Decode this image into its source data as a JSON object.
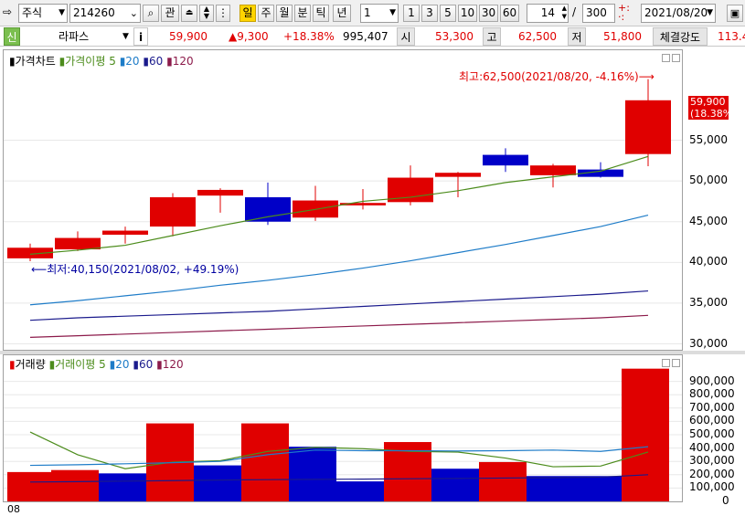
{
  "toolbar": {
    "market_type": "주식",
    "code": "214260",
    "btn_watch": "관",
    "period_active": "일",
    "periods": [
      "주",
      "월",
      "분",
      "틱",
      "년"
    ],
    "interval_value": "1",
    "minute_buttons": [
      "1",
      "3",
      "5",
      "10",
      "30",
      "60"
    ],
    "view_count": "14",
    "separator": "/",
    "total_count": "300",
    "date_value": "2021/08/20"
  },
  "infobar": {
    "badge": "신",
    "stock_name": "라파스",
    "info_button": "i",
    "price": "59,900",
    "change": "▲9,300",
    "change_pct": "+18.38%",
    "volume": "995,407",
    "open_label": "시",
    "open_value": "53,300",
    "high_label": "고",
    "high_value": "62,500",
    "low_label": "저",
    "low_value": "51,800",
    "strength_label": "체결강도",
    "strength_value": "113.4"
  },
  "price_panel": {
    "legend": {
      "title": "가격차트",
      "ma_title": "가격이평",
      "ma_periods": [
        "5",
        "20",
        "60",
        "120"
      ]
    },
    "high_annotation": "최고:62,500(2021/08/20, -4.16%)⟶",
    "low_annotation": "⟵최저:40,150(2021/08/02, +49.19%)",
    "current_tag_price": "59,900",
    "current_tag_pct": "(18.38%)"
  },
  "volume_panel": {
    "legend": {
      "title": "거래량",
      "ma_title": "거래이평",
      "ma_periods": [
        "5",
        "20",
        "60",
        "120"
      ]
    }
  },
  "bottom_label": "08",
  "colors": {
    "up": "#e00000",
    "down": "#0000c8",
    "ma5": "#4c8c1c",
    "ma20": "#1e7cc8",
    "ma60": "#1a1a8c",
    "ma120": "#8c1a4a",
    "grid": "#e8e8e8"
  },
  "chart_data": [
    {
      "type": "candlestick",
      "title": "가격차트",
      "y_ticks": [
        "30,000",
        "35,000",
        "40,000",
        "45,000",
        "50,000",
        "55,000"
      ],
      "ylim": [
        29500,
        63800
      ],
      "candles": [
        {
          "o": 41800,
          "h": 42300,
          "l": 40150,
          "c": 40500
        },
        {
          "o": 41600,
          "h": 43800,
          "l": 41400,
          "c": 43000
        },
        {
          "o": 43900,
          "h": 44400,
          "l": 42300,
          "c": 43400
        },
        {
          "o": 48000,
          "h": 48500,
          "l": 43200,
          "c": 44400
        },
        {
          "o": 48900,
          "h": 49100,
          "l": 46100,
          "c": 48200
        },
        {
          "o": 48000,
          "h": 49800,
          "l": 44600,
          "c": 45000
        },
        {
          "o": 47600,
          "h": 49400,
          "l": 45100,
          "c": 45500
        },
        {
          "o": 47300,
          "h": 49000,
          "l": 46500,
          "c": 47000
        },
        {
          "o": 50400,
          "h": 51900,
          "l": 47000,
          "c": 47400
        },
        {
          "o": 51000,
          "h": 51100,
          "l": 48000,
          "c": 50500
        },
        {
          "o": 51900,
          "h": 54000,
          "l": 51100,
          "c": 53200
        },
        {
          "o": 51900,
          "h": 52100,
          "l": 49200,
          "c": 50700
        },
        {
          "o": 50500,
          "h": 52300,
          "l": 50400,
          "c": 51400
        },
        {
          "o": 59900,
          "h": 62500,
          "l": 51800,
          "c": 53300
        }
      ],
      "ma": {
        "ma5": [
          41000,
          41500,
          42100,
          43300,
          44500,
          45600,
          46500,
          47500,
          48000,
          48800,
          49800,
          50500,
          51200,
          53000
        ],
        "ma20": [
          null,
          null,
          null,
          null,
          null,
          null,
          null,
          null,
          null,
          null,
          null,
          null,
          null,
          null
        ],
        "ma20_line": [
          34800,
          35300,
          35900,
          36500,
          37200,
          37800,
          38500,
          39300,
          40200,
          41200,
          42200,
          43300,
          44400,
          45800
        ],
        "ma60": [
          32900,
          33200,
          33400,
          33600,
          33800,
          34000,
          34300,
          34600,
          34900,
          35200,
          35500,
          35800,
          36100,
          36500
        ],
        "ma120": [
          30800,
          31000,
          31200,
          31400,
          31600,
          31800,
          32000,
          32200,
          32400,
          32600,
          32800,
          33000,
          33200,
          33500
        ]
      }
    },
    {
      "type": "bar",
      "title": "거래량",
      "y_ticks": [
        "0",
        "100,000",
        "200,000",
        "300,000",
        "400,000",
        "500,000",
        "600,000",
        "700,000",
        "800,000",
        "900,000"
      ],
      "ylim": [
        0,
        1000000
      ],
      "values": [
        220000,
        235000,
        210000,
        585000,
        270000,
        585000,
        410000,
        150000,
        445000,
        245000,
        295000,
        190000,
        190000,
        995407
      ],
      "up": [
        true,
        true,
        false,
        true,
        false,
        true,
        false,
        false,
        true,
        false,
        true,
        false,
        false,
        true
      ],
      "ma5": [
        520000,
        350000,
        245000,
        295000,
        305000,
        375000,
        405000,
        395000,
        375000,
        370000,
        325000,
        260000,
        265000,
        370000
      ],
      "ma20": [
        270000,
        275000,
        282000,
        290000,
        300000,
        350000,
        385000,
        380000,
        380000,
        378000,
        380000,
        385000,
        375000,
        410000
      ],
      "ma60": [
        145000,
        148000,
        152000,
        156000,
        160000,
        163000,
        165000,
        167000,
        170000,
        172000,
        175000,
        178000,
        182000,
        200000
      ]
    }
  ]
}
